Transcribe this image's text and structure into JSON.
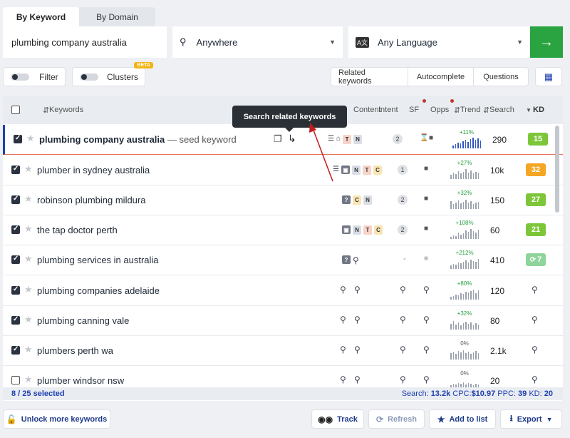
{
  "tabs": [
    "By Keyword",
    "By Domain"
  ],
  "search": {
    "query": "plumbing company australia",
    "location": "Anywhere",
    "language": "Any Language",
    "go": "→"
  },
  "controls": {
    "filter": "Filter",
    "clusters": "Clusters",
    "beta": "BETA",
    "related": "Related keywords",
    "autocomplete": "Autocomplete",
    "questions": "Questions"
  },
  "table_header": {
    "keywords": "Keywords",
    "content": "Content",
    "intent": "Intent",
    "sf": "SF",
    "opps": "Opps",
    "trend": "Trend",
    "search": "Search",
    "kd": "KD"
  },
  "tooltip": "Search related keywords",
  "rows": [
    {
      "keyword": "plumbing company australia",
      "seed": "— seed keyword",
      "checked": true,
      "sf": "2",
      "trend": "+11%",
      "search": "290",
      "kd": "15",
      "kd_color": "#7dc63a"
    },
    {
      "keyword": "plumber in sydney australia",
      "checked": true,
      "sf": "1",
      "trend": "+27%",
      "search": "10k",
      "kd": "32",
      "kd_color": "#f5a623"
    },
    {
      "keyword": "robinson plumbing mildura",
      "checked": true,
      "sf": "2",
      "trend": "+32%",
      "search": "150",
      "kd": "27",
      "kd_color": "#7dc63a"
    },
    {
      "keyword": "the tap doctor perth",
      "checked": true,
      "sf": "2",
      "trend": "+108%",
      "search": "60",
      "kd": "21",
      "kd_color": "#7dc63a"
    },
    {
      "keyword": "plumbing services in australia",
      "checked": true,
      "sf": "-",
      "trend": "+212%",
      "search": "410",
      "kd": "7",
      "kd_color": "#8fd49a"
    },
    {
      "keyword": "plumbing companies adelaide",
      "checked": true,
      "trend": "+80%",
      "search": "120"
    },
    {
      "keyword": "plumbing canning vale",
      "checked": true,
      "trend": "+32%",
      "search": "80"
    },
    {
      "keyword": "plumbers perth wa",
      "checked": true,
      "trend": "0%",
      "search": "2.1k"
    },
    {
      "keyword": "plumber windsor nsw",
      "checked": false,
      "trend": "0%",
      "search": "20"
    }
  ],
  "footer": {
    "selected": "8 / 25 selected",
    "search_label": "Search:",
    "search_val": "13.2k",
    "cpc_label": "CPC:",
    "cpc_val": "$10.97",
    "ppc_label": "PPC:",
    "ppc_val": "39",
    "kd_label": "KD:",
    "kd_val": "20"
  },
  "actions": {
    "unlock": "Unlock more keywords",
    "track": "Track",
    "refresh": "Refresh",
    "add": "Add to list",
    "export": "Export"
  }
}
